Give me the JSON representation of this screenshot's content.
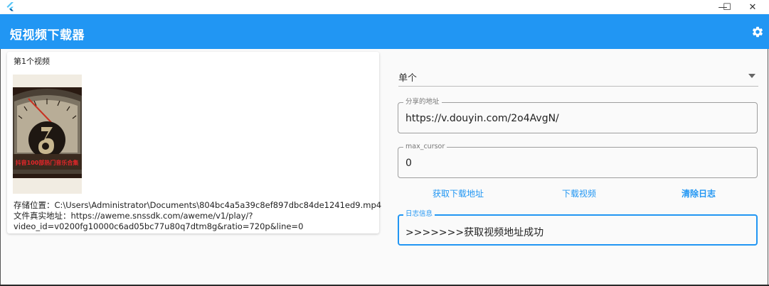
{
  "window": {
    "controls": {
      "minimize": "—",
      "maximize": "☐",
      "close": "✕"
    }
  },
  "appbar": {
    "title": "短视频下载器",
    "settings_icon": "gear-icon",
    "color": "#2196f3"
  },
  "video_card": {
    "title": "第1个视频",
    "thumbnail_caption": "抖音100部热门音乐合集",
    "save_location": "存储位置：C:\\Users\\Administrator\\Documents\\804bc4a5a39c8ef897dbc84de1241ed9.mp4",
    "real_address_line1": "文件真实地址：https://aweme.snssdk.com/aweme/v1/play/?",
    "real_address_line2": "video_id=v0200fg10000c6ad05bc77u80q7dtm8g&ratio=720p&line=0"
  },
  "form": {
    "mode_select": {
      "value": "单个"
    },
    "share_url": {
      "label": "分享的地址",
      "value": "https://v.douyin.com/2o4AvgN/"
    },
    "max_cursor": {
      "label": "max_cursor",
      "value": "0"
    },
    "buttons": {
      "get_url": "获取下载地址",
      "download": "下载视频",
      "clear_log": "清除日志"
    },
    "log": {
      "label": "日志信息",
      "value": ">>>>>>>获取视频地址成功"
    }
  }
}
